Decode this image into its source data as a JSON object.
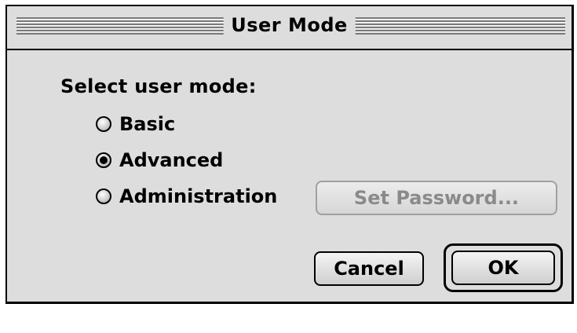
{
  "dialog": {
    "title": "User Mode",
    "prompt": "Select user mode:",
    "options": [
      {
        "label": "Basic",
        "selected": false
      },
      {
        "label": "Advanced",
        "selected": true
      },
      {
        "label": "Administration",
        "selected": false
      }
    ],
    "set_password_label": "Set Password...",
    "set_password_enabled": false,
    "cancel_label": "Cancel",
    "ok_label": "OK"
  }
}
